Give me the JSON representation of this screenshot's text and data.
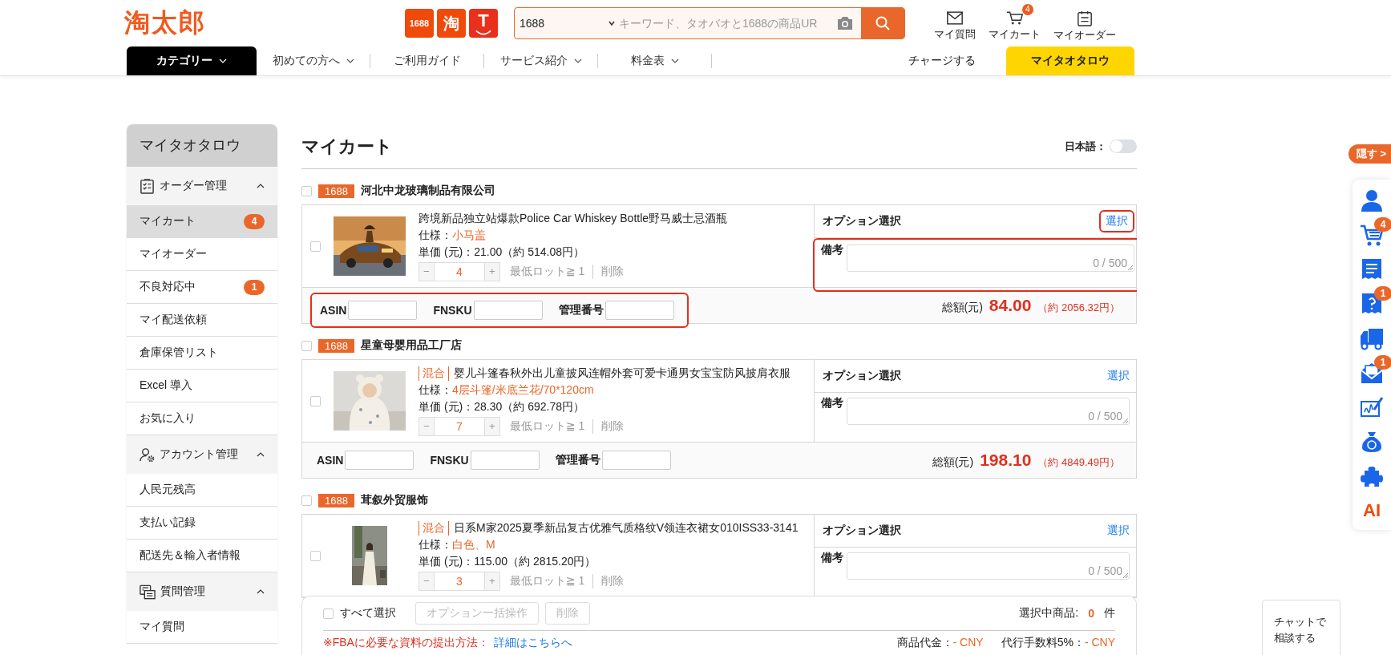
{
  "header": {
    "logo": "淘太郎",
    "platforms": [
      {
        "kind": "alibaba",
        "label": "1688"
      },
      {
        "kind": "taobao",
        "label": "淘"
      },
      {
        "kind": "tmall",
        "label": "T"
      }
    ],
    "search": {
      "source": "1688",
      "placeholder": "キーワード、タオバオと1688の商品UR"
    },
    "actions": [
      {
        "kind": "mail",
        "label": "マイ質問"
      },
      {
        "kind": "cart",
        "label": "マイカート",
        "badge": "4"
      },
      {
        "kind": "orders",
        "label": "マイオーダー"
      }
    ]
  },
  "nav": [
    {
      "kind": "category",
      "label": "カテゴリー",
      "dropdown": true
    },
    {
      "kind": "link",
      "label": "初めての方へ",
      "dropdown": true
    },
    {
      "kind": "link",
      "label": "ご利用ガイド",
      "dropdown": false
    },
    {
      "kind": "link",
      "label": "サービス紹介",
      "dropdown": true
    },
    {
      "kind": "link",
      "label": "料金表",
      "dropdown": true
    },
    {
      "kind": "plain",
      "label": "チャージする",
      "dropdown": false
    },
    {
      "kind": "highlight",
      "label": "マイタオタロウ",
      "dropdown": false
    }
  ],
  "sidebar": {
    "title": "マイタオタロウ",
    "groups": [
      {
        "kind": "orders",
        "title": "オーダー管理",
        "expanded": true,
        "items": [
          {
            "label": "マイカート",
            "selected": true,
            "badge": "4"
          },
          {
            "label": "マイオーダー",
            "selected": false
          },
          {
            "label": "不良対応中",
            "selected": false,
            "badge": "1"
          },
          {
            "label": "マイ配送依頼",
            "selected": false
          },
          {
            "label": "倉庫保管リスト",
            "selected": false
          },
          {
            "label": "Excel 導入",
            "selected": false
          },
          {
            "label": "お気に入り",
            "selected": false
          }
        ]
      },
      {
        "kind": "account",
        "title": "アカウント管理",
        "expanded": true,
        "items": [
          {
            "label": "人民元残高",
            "selected": false
          },
          {
            "label": "支払い記録",
            "selected": false
          },
          {
            "label": "配送先＆輸入者情報",
            "selected": false
          }
        ]
      },
      {
        "kind": "question",
        "title": "質問管理",
        "expanded": true,
        "items": [
          {
            "label": "マイ質問",
            "selected": false
          }
        ]
      }
    ]
  },
  "cart": {
    "title": "マイカート",
    "language": {
      "label": "日本語：",
      "on": false
    },
    "stores": [
      {
        "platform": "1688",
        "name": "河北中龙玻璃制品有限公司",
        "checked": false,
        "items": [
          {
            "checked": false,
            "annotated": true,
            "title": "跨境新品独立站爆款Police Car Whiskey Bottle野马威士忌酒瓶",
            "spec_label": "仕様：",
            "spec": "小马盖",
            "price": "単価 (元)：21.00（約 514.08円）",
            "minus": "−",
            "quantity": "4",
            "plus": "+",
            "min_lot": "最低ロット≧ 1",
            "delete": "削除",
            "option_label": "オプション選択",
            "select": "選択",
            "memo_label": "備考",
            "memo_count": "0 / 500",
            "id_fields": [
              "ASIN",
              "FNSKU",
              "管理番号"
            ],
            "total_label": "総額(元)",
            "total": "84.00",
            "total_yen": "（約 2056.32円）"
          }
        ]
      },
      {
        "platform": "1688",
        "name": "星童母婴用品工厂店",
        "checked": false,
        "items": [
          {
            "checked": false,
            "annotated": false,
            "tag": "混合",
            "title": "婴儿斗篷春秋外出儿童披风连帽外套可爱卡通男女宝宝防风披肩衣服",
            "spec_label": "仕様：",
            "spec": "4层斗篷/米底兰花/70*120cm",
            "price": "単価 (元)：28.30（約 692.78円）",
            "minus": "−",
            "quantity": "7",
            "plus": "+",
            "min_lot": "最低ロット≧ 1",
            "delete": "削除",
            "option_label": "オプション選択",
            "select": "選択",
            "memo_label": "備考",
            "memo_count": "0 / 500",
            "id_fields": [
              "ASIN",
              "FNSKU",
              "管理番号"
            ],
            "total_label": "総額(元)",
            "total": "198.10",
            "total_yen": "（約 4849.49円）"
          }
        ]
      },
      {
        "platform": "1688",
        "name": "茸叙外贸服饰",
        "checked": false,
        "items": [
          {
            "checked": false,
            "annotated": false,
            "tag": "混合",
            "title": "日系M家2025夏季新品复古优雅气质格纹V领连衣裙女010ISS33-3141",
            "spec_label": "仕様：",
            "spec": "白色、M",
            "price": "単価 (元)：115.00（約 2815.20円）",
            "minus": "−",
            "quantity": "3",
            "plus": "+",
            "min_lot": "最低ロット≧ 1",
            "delete": "削除",
            "option_label": "オプション選択",
            "select": "選択",
            "memo_label": "備考",
            "memo_count": "0 / 500"
          }
        ]
      }
    ]
  },
  "footer_bar": {
    "select_all": "すべて選択",
    "checked": false,
    "buttons": [
      {
        "label": "オプション一括操作",
        "disabled": true
      },
      {
        "label": "削除",
        "disabled": true
      }
    ],
    "count_label": "選択中商品:",
    "count": "0",
    "count_unit": "件",
    "fba_note": "※FBAに必要な資料の提出方法：",
    "fba_link": "詳細はこちらへ",
    "fees": [
      {
        "label": "商品代金：",
        "value": "- CNY"
      },
      {
        "label": "代行手数料5%：",
        "value": "- CNY"
      }
    ]
  },
  "rail": {
    "hide": "隠す >",
    "items": [
      {
        "kind": "user"
      },
      {
        "kind": "cart",
        "badge": "4"
      },
      {
        "kind": "receipt"
      },
      {
        "kind": "question",
        "badge": "1"
      },
      {
        "kind": "truck"
      },
      {
        "kind": "mail",
        "badge": "1"
      },
      {
        "kind": "signature"
      },
      {
        "kind": "money"
      },
      {
        "kind": "puzzle"
      },
      {
        "kind": "ai",
        "label": "AI"
      }
    ]
  },
  "chat": {
    "lines": [
      "チャットで",
      "相談する"
    ]
  }
}
